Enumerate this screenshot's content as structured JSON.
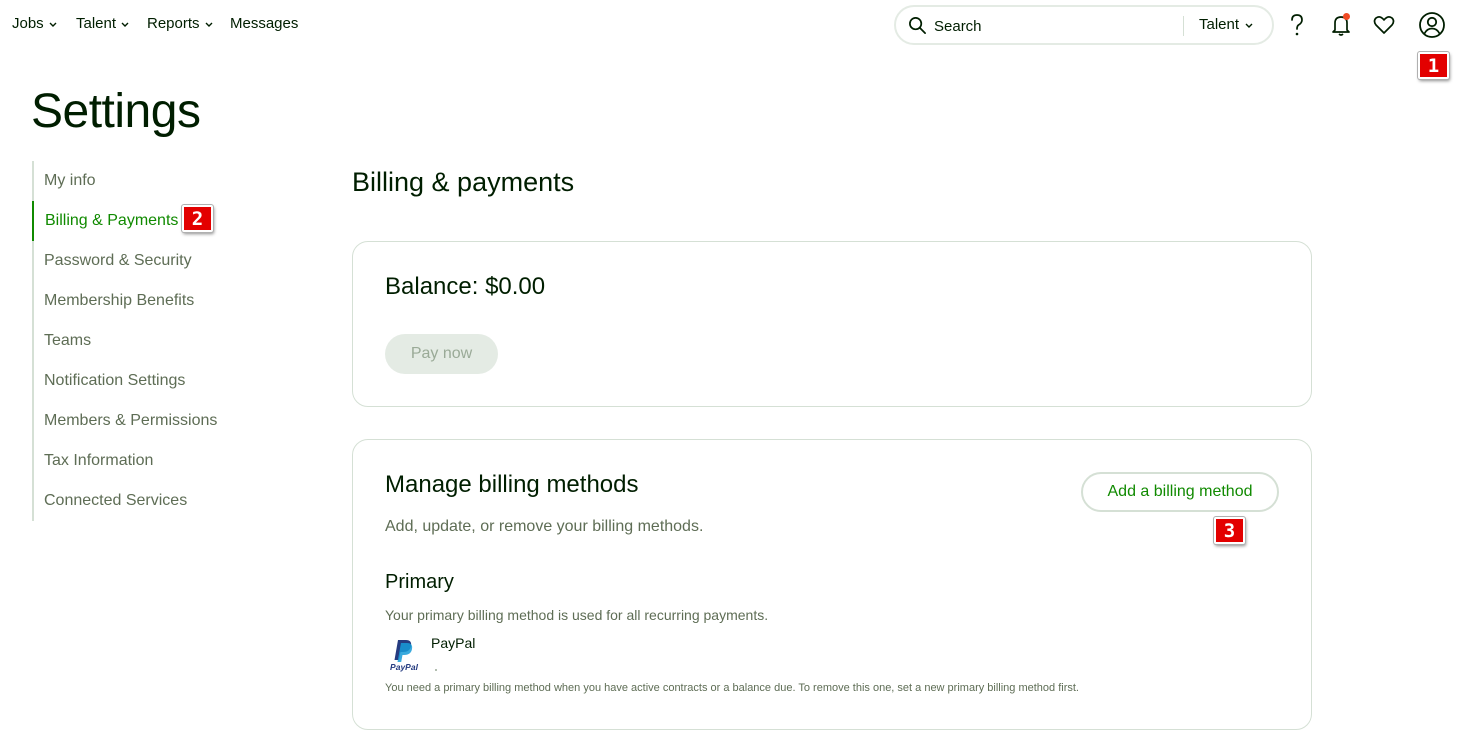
{
  "nav": {
    "items": [
      {
        "label": "Jobs",
        "has_dropdown": true
      },
      {
        "label": "Talent",
        "has_dropdown": true
      },
      {
        "label": "Reports",
        "has_dropdown": true
      },
      {
        "label": "Messages",
        "has_dropdown": false
      }
    ],
    "search": {
      "placeholder": "Search",
      "scope": "Talent"
    },
    "icons": [
      "search-icon",
      "help-icon",
      "bell-icon",
      "heart-icon",
      "user-icon"
    ],
    "notification_dot_color": "#f04a24"
  },
  "badges": {
    "b1": "1",
    "b2": "2",
    "b3": "3"
  },
  "page_title": "Settings",
  "sidebar": {
    "items": [
      {
        "label": "My info"
      },
      {
        "label": "Billing & Payments",
        "active": true
      },
      {
        "label": "Password & Security"
      },
      {
        "label": "Membership Benefits"
      },
      {
        "label": "Teams"
      },
      {
        "label": "Notification Settings"
      },
      {
        "label": "Members & Permissions"
      },
      {
        "label": "Tax Information"
      },
      {
        "label": "Connected Services"
      }
    ]
  },
  "main": {
    "heading": "Billing & payments",
    "balance_card": {
      "balance": "Balance: $0.00",
      "pay_button": "Pay now"
    },
    "billing_card": {
      "title": "Manage billing methods",
      "subtitle": "Add, update, or remove your billing methods.",
      "add_button": "Add a billing method",
      "primary_heading": "Primary",
      "primary_description": "Your primary billing method is used for all recurring payments.",
      "method_name": "PayPal",
      "method_logo_text": "PayPal",
      "note": "You need a primary billing method when you have active contracts or a balance due. To remove this one, set a new primary billing method first."
    }
  },
  "colors": {
    "accent_green": "#108a00",
    "text_dark": "#001e00",
    "text_muted": "#5e6d55",
    "border": "#d5e0d5",
    "badge_red": "#e30000"
  }
}
